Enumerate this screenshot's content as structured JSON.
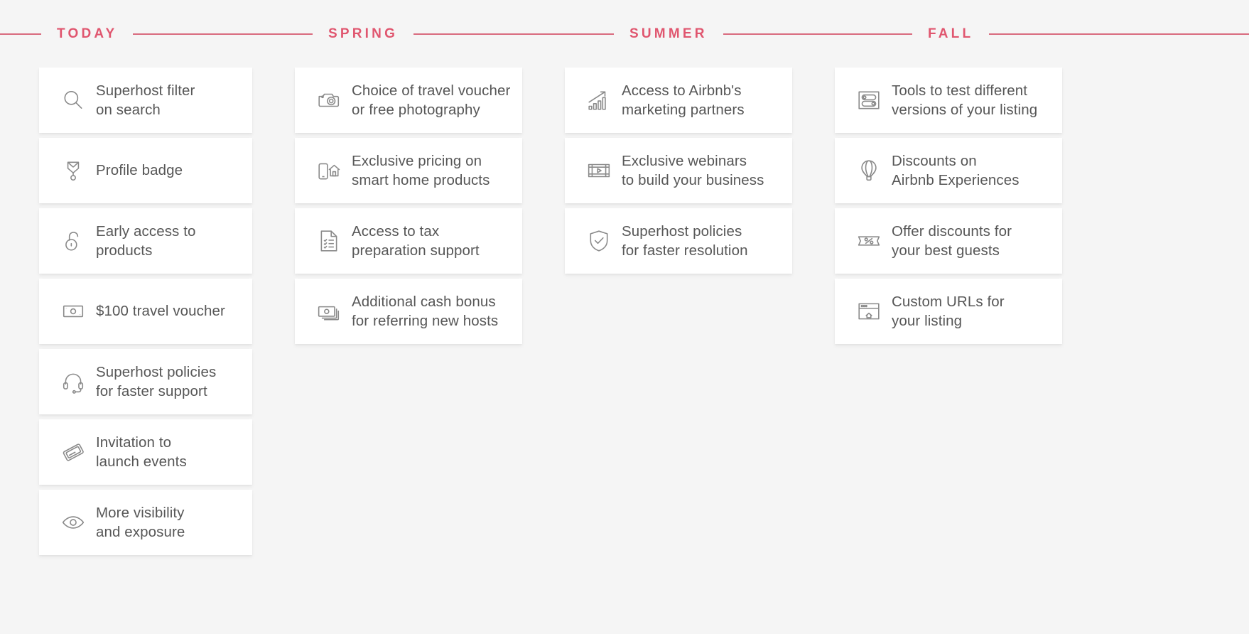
{
  "timeline": {
    "sections": [
      {
        "label": "TODAY"
      },
      {
        "label": "SPRING"
      },
      {
        "label": "SUMMER"
      },
      {
        "label": "FALL"
      }
    ],
    "line_color": "#d96b7e",
    "label_color": "#e0566f"
  },
  "columns": [
    {
      "heading": "TODAY",
      "cards": [
        {
          "icon": "search-icon",
          "text": "Superhost filter\non search"
        },
        {
          "icon": "medal-badge-icon",
          "text": "Profile badge"
        },
        {
          "icon": "unlocked-padlock-icon",
          "text": "Early access to products"
        },
        {
          "icon": "cash-banknote-icon",
          "text": "$100 travel voucher"
        },
        {
          "icon": "headset-support-icon",
          "text": "Superhost policies\nfor faster support"
        },
        {
          "icon": "invitation-ticket-icon",
          "text": "Invitation to\nlaunch events"
        },
        {
          "icon": "eye-visibility-icon",
          "text": "More visibility\nand exposure"
        }
      ]
    },
    {
      "heading": "SPRING",
      "cards": [
        {
          "icon": "camera-icon",
          "text": "Choice of travel voucher\nor free photography"
        },
        {
          "icon": "smart-home-phone-icon",
          "text": "Exclusive pricing on\nsmart home products"
        },
        {
          "icon": "tax-document-checklist-icon",
          "text": "Access to tax\npreparation support"
        },
        {
          "icon": "cash-stack-icon",
          "text": "Additional cash bonus\nfor referring new hosts"
        }
      ]
    },
    {
      "heading": "SUMMER",
      "cards": [
        {
          "icon": "growth-bar-chart-icon",
          "text": "Access to Airbnb's\nmarketing partners"
        },
        {
          "icon": "video-webinar-icon",
          "text": "Exclusive webinars\nto build your business"
        },
        {
          "icon": "shield-check-icon",
          "text": "Superhost policies\nfor faster resolution"
        }
      ]
    },
    {
      "heading": "FALL",
      "cards": [
        {
          "icon": "ab-test-toggles-icon",
          "text": "Tools to test different\nversions of your listing"
        },
        {
          "icon": "hot-air-balloon-icon",
          "text": "Discounts on\nAirbnb Experiences"
        },
        {
          "icon": "percent-coupon-icon",
          "text": "Offer discounts for\nyour best guests"
        },
        {
          "icon": "browser-window-icon",
          "text": "Custom URLs for\nyour listing"
        }
      ]
    }
  ]
}
